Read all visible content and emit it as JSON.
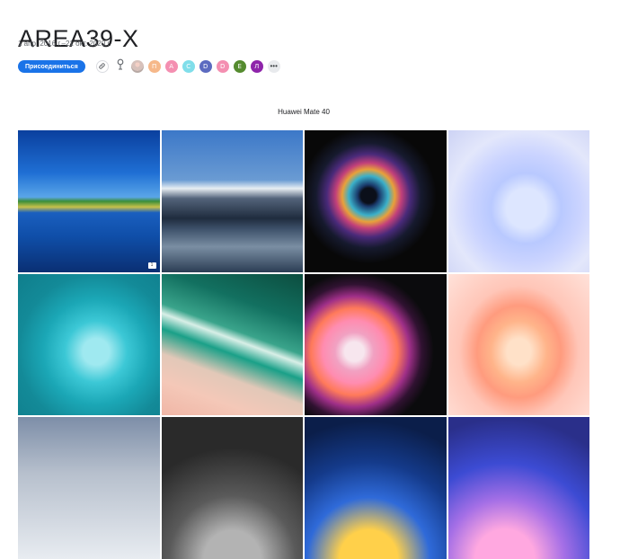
{
  "album": {
    "title": "AREA39-X",
    "date_range": "1 апр. 2016 г.–21 окт. 2020 г."
  },
  "actions": {
    "join_label": "Присоединиться",
    "share_icon": "link-icon",
    "person_icon": "person-icon",
    "more_icon": "more-horiz-icon"
  },
  "members": [
    {
      "letter": "",
      "color": "#d7c1bb"
    },
    {
      "letter": "П",
      "color": "#f6b88a"
    },
    {
      "letter": "А",
      "color": "#f48fb1"
    },
    {
      "letter": "С",
      "color": "#80deea"
    },
    {
      "letter": "D",
      "color": "#5c6bc0"
    },
    {
      "letter": "D",
      "color": "#f48fb1"
    },
    {
      "letter": "Е",
      "color": "#558b2f"
    },
    {
      "letter": "Л",
      "color": "#8e24aa"
    }
  ],
  "section": {
    "label": "Huawei Mate 40"
  },
  "photos": [
    {
      "id": "t1",
      "subject": "lake-trees",
      "has_comment": true
    },
    {
      "id": "t2",
      "subject": "mountain-lake",
      "has_comment": false
    },
    {
      "id": "t3",
      "subject": "dark-burst",
      "has_comment": false
    },
    {
      "id": "t4",
      "subject": "lavender-ribbon",
      "has_comment": false
    },
    {
      "id": "t5",
      "subject": "teal-ribbon",
      "has_comment": false
    },
    {
      "id": "t6",
      "subject": "beach-aerial",
      "has_comment": false
    },
    {
      "id": "t7",
      "subject": "pink-flower",
      "has_comment": false
    },
    {
      "id": "t8",
      "subject": "peach-ribbon",
      "has_comment": false
    },
    {
      "id": "t9",
      "subject": "grey-sphere",
      "has_comment": false
    },
    {
      "id": "t10",
      "subject": "dark-sphere",
      "has_comment": false
    },
    {
      "id": "t11",
      "subject": "blue-yellow-burst",
      "has_comment": false
    },
    {
      "id": "t12",
      "subject": "purple-burst",
      "has_comment": false
    }
  ]
}
